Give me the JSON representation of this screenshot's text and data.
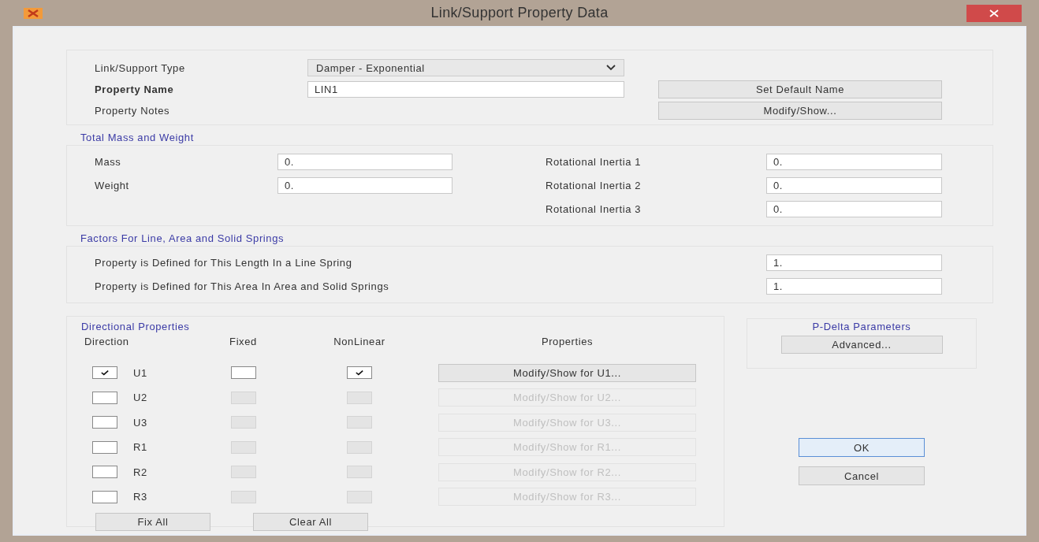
{
  "window": {
    "title": "Link/Support Property Data"
  },
  "general": {
    "type_label": "Link/Support Type",
    "type_value": "Damper - Exponential",
    "name_label": "Property Name",
    "name_value": "LIN1",
    "notes_label": "Property Notes",
    "set_default_button": "Set Default Name",
    "notes_button": "Modify/Show..."
  },
  "mass_weight": {
    "title": "Total Mass and Weight",
    "fields": [
      {
        "label": "Mass",
        "value": "0."
      },
      {
        "label": "Weight",
        "value": "0."
      }
    ],
    "inertia": [
      {
        "label": "Rotational Inertia 1",
        "value": "0."
      },
      {
        "label": "Rotational Inertia 2",
        "value": "0."
      },
      {
        "label": "Rotational Inertia 3",
        "value": "0."
      }
    ]
  },
  "factors": {
    "title": "Factors For Line, Area and Solid Springs",
    "fields": [
      {
        "label": "Property is Defined for This Length In a Line Spring",
        "value": "1."
      },
      {
        "label": "Property is Defined for This Area In Area and Solid Springs",
        "value": "1."
      }
    ]
  },
  "directional": {
    "title": "Directional Properties",
    "columns": [
      "Direction",
      "Fixed",
      "NonLinear",
      "Properties"
    ],
    "rows": [
      {
        "direction": "U1",
        "checked": true,
        "fixed": false,
        "nonlinear": true,
        "disabled": false,
        "button": "Modify/Show for U1..."
      },
      {
        "direction": "U2",
        "checked": false,
        "fixed": false,
        "nonlinear": false,
        "disabled": true,
        "button": "Modify/Show for U2..."
      },
      {
        "direction": "U3",
        "checked": false,
        "fixed": false,
        "nonlinear": false,
        "disabled": true,
        "button": "Modify/Show for U3..."
      },
      {
        "direction": "R1",
        "checked": false,
        "fixed": false,
        "nonlinear": false,
        "disabled": true,
        "button": "Modify/Show for R1..."
      },
      {
        "direction": "R2",
        "checked": false,
        "fixed": false,
        "nonlinear": false,
        "disabled": true,
        "button": "Modify/Show for R2..."
      },
      {
        "direction": "R3",
        "checked": false,
        "fixed": false,
        "nonlinear": false,
        "disabled": true,
        "button": "Modify/Show for R3..."
      }
    ],
    "buttons": [
      "Fix All",
      "Clear All"
    ]
  },
  "p_delta": {
    "title": "P-Delta Parameters",
    "button": "Advanced..."
  },
  "buttons": [
    {
      "label": "OK",
      "default": true
    },
    {
      "label": "Cancel",
      "default": false
    }
  ]
}
